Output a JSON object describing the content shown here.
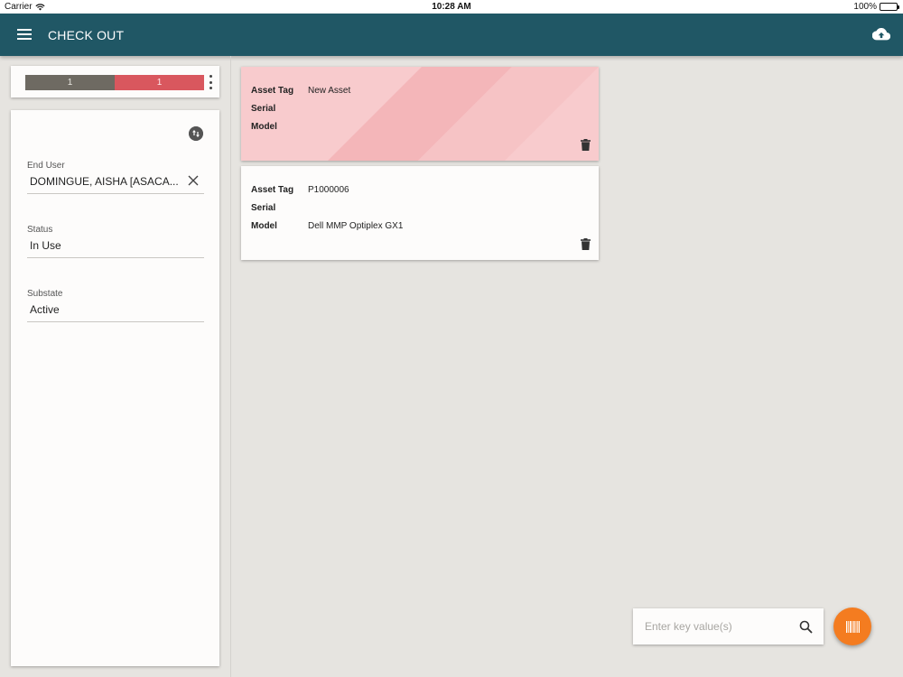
{
  "status_bar": {
    "carrier": "Carrier",
    "time": "10:28 AM",
    "battery": "100%"
  },
  "app_bar": {
    "title": "CHECK OUT",
    "menu_icon": "menu-icon",
    "upload_icon": "cloud-upload-icon",
    "color": "#205765"
  },
  "progress": {
    "segments": [
      {
        "count": "1",
        "color": "#6e6a62"
      },
      {
        "count": "1",
        "color": "#d9575e"
      }
    ]
  },
  "form": {
    "end_user": {
      "label": "End User",
      "value": "DOMINGUE, AISHA [ASACA..."
    },
    "status": {
      "label": "Status",
      "value": "In Use"
    },
    "substate": {
      "label": "Substate",
      "value": "Active"
    }
  },
  "assets": [
    {
      "state": "new",
      "fields": [
        {
          "key": "Asset Tag",
          "value": "New Asset"
        },
        {
          "key": "Serial",
          "value": ""
        },
        {
          "key": "Model",
          "value": ""
        }
      ],
      "background": "#f8cbcd"
    },
    {
      "state": "existing",
      "fields": [
        {
          "key": "Asset Tag",
          "value": "P1000006"
        },
        {
          "key": "Serial",
          "value": ""
        },
        {
          "key": "Model",
          "value": "Dell MMP Optiplex GX1"
        }
      ],
      "background": "#fdfcfb"
    }
  ],
  "search": {
    "placeholder": "Enter key value(s)",
    "value": ""
  },
  "fab": {
    "icon": "barcode-scan-icon",
    "color": "#f47c20"
  }
}
